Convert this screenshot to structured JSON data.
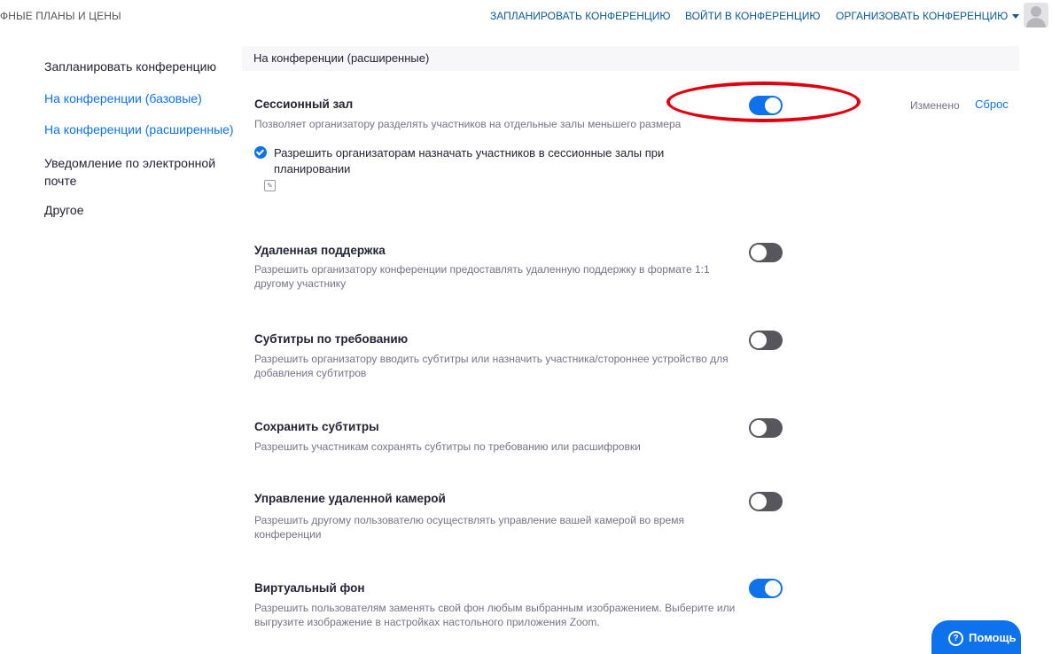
{
  "topbar": {
    "left_text": "ФНЫЕ ПЛАНЫ И ЦЕНЫ",
    "schedule_link": "ЗАПЛАНИРОВАТЬ КОНФЕРЕНЦИЮ",
    "join_link": "ВОЙТИ В КОНФЕРЕНЦИЮ",
    "host_link": "ОРГАНИЗОВАТЬ КОНФЕРЕНЦИЮ"
  },
  "sidebar": {
    "items": [
      {
        "label": "Запланировать конференцию",
        "active": false
      },
      {
        "label": "На конференции (базовые)",
        "active": true
      },
      {
        "label": "На конференции (расширенные)",
        "active": true
      },
      {
        "label": "Уведомление по электронной почте",
        "active": false
      },
      {
        "label": "Другое",
        "active": false
      }
    ]
  },
  "section": {
    "header": "На конференции (расширенные)"
  },
  "settings": [
    {
      "title": "Сессионный зал",
      "description": "Позволяет организатору разделять участников на отдельные залы меньшего размера",
      "enabled": true,
      "status": "Изменено",
      "reset": "Сброс",
      "checkbox_label": "Разрешить организаторам назначать участников в сессионные залы при планировании",
      "checkbox_checked": true,
      "info_icon": "edit-icon"
    },
    {
      "title": "Удаленная поддержка",
      "description": "Разрешить организатору конференции предоставлять удаленную поддержку в формате 1:1 другому участнику",
      "enabled": false
    },
    {
      "title": "Субтитры по требованию",
      "description": "Разрешить организатору вводить субтитры или назначить участника/стороннее устройство для добавления субтитров",
      "enabled": false
    },
    {
      "title": "Сохранить субтитры",
      "description": "Разрешить участникам сохранять субтитры по требованию или расшифровки",
      "enabled": false
    },
    {
      "title": "Управление удаленной камерой",
      "description": "Разрешить другому пользователю осуществлять управление вашей камерой во время конференции",
      "enabled": false
    },
    {
      "title": "Виртуальный фон",
      "description": "Разрешить пользователям заменять свой фон любым выбранным изображением. Выберите или выгрузите изображение в настройках настольного приложения Zoom.",
      "enabled": true
    }
  ],
  "help": {
    "label": "Помощь",
    "icon": "question-icon"
  },
  "colors": {
    "accent": "#0e72ed",
    "toggle_off": "#56565c",
    "annotation": "#e0000e"
  }
}
